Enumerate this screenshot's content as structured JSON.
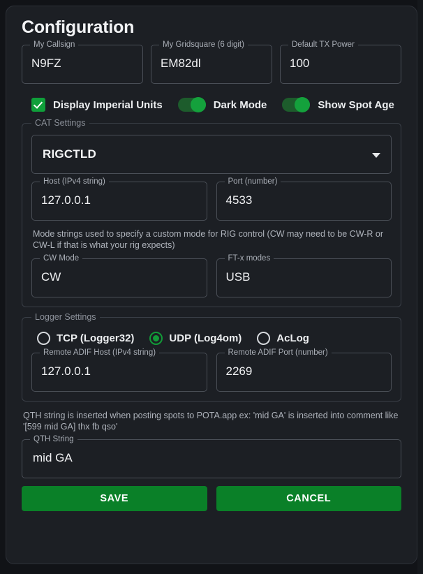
{
  "dialog": {
    "title": "Configuration"
  },
  "identity": {
    "fields": [
      {
        "label": "My Callsign",
        "value": "N9FZ"
      },
      {
        "label": "My Gridsquare (6 digit)",
        "value": "EM82dl"
      },
      {
        "label": "Default TX Power",
        "value": "100"
      }
    ]
  },
  "options": [
    {
      "label": "Display Imperial Units",
      "control": "checkbox",
      "checked": true
    },
    {
      "label": "Dark Mode",
      "control": "toggle",
      "checked": true
    },
    {
      "label": "Show Spot Age",
      "control": "toggle",
      "checked": true
    }
  ],
  "cat_settings": {
    "legend": "CAT Settings",
    "rig_select": {
      "label": "RIGCTLD",
      "icon": "chevron-down-icon"
    },
    "host": {
      "label": "Host (IPv4 string)",
      "value": "127.0.0.1"
    },
    "port": {
      "label": "Port (number)",
      "value": "4533"
    },
    "helper": "Mode strings used to specify a custom mode for RIG control (CW may need to be CW-R or CW-L if that is what your rig expects)",
    "cw_mode": {
      "label": "CW Mode",
      "value": "CW"
    },
    "ftx_modes": {
      "label": "FT-x modes",
      "value": "USB"
    }
  },
  "logger_settings": {
    "legend": "Logger Settings",
    "radios": [
      {
        "label": "TCP (Logger32)",
        "selected": false
      },
      {
        "label": "UDP (Log4om)",
        "selected": true
      },
      {
        "label": "AcLog",
        "selected": false
      }
    ],
    "adif_host": {
      "label": "Remote ADIF Host (IPv4 string)",
      "value": "127.0.0.1"
    },
    "adif_port": {
      "label": "Remote ADIF Port (number)",
      "value": "2269"
    }
  },
  "qth": {
    "helper": "QTH string is inserted when posting spots to POTA.app ex: 'mid GA' is inserted into comment like '[599 mid GA] thx fb qso'",
    "field": {
      "label": "QTH String",
      "value": "mid GA"
    }
  },
  "actions": {
    "save_label": "SAVE",
    "cancel_label": "CANCEL"
  },
  "colors": {
    "accent_green": "#0a8028",
    "toggle_thumb": "#14a13c",
    "checkbox_green": "#0f9f3a",
    "card_bg": "#1c1f24",
    "page_bg": "#111317",
    "field_border": "#4a4f57",
    "group_border": "#3a3f47"
  }
}
